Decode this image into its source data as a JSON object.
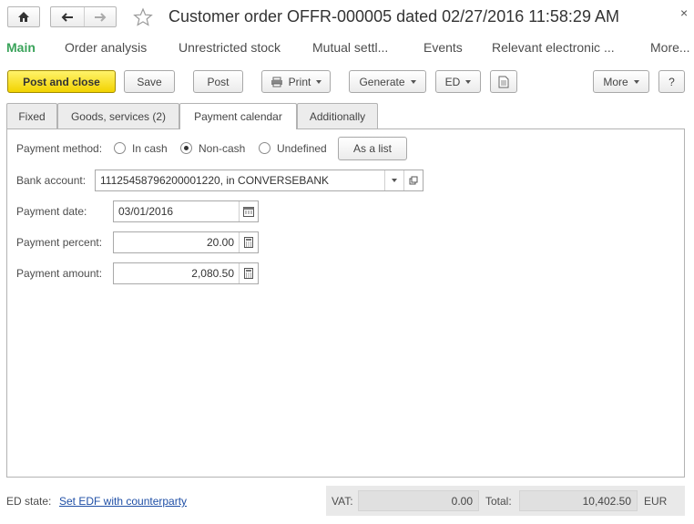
{
  "window": {
    "title": "Customer order OFFR-000005 dated 02/27/2016 11:58:29 AM",
    "close_glyph": "×"
  },
  "sections": {
    "main": "Main",
    "order_analysis": "Order analysis",
    "unrestricted_stock": "Unrestricted stock",
    "mutual_settl": "Mutual settl...",
    "events": "Events",
    "relevant_electronic": "Relevant electronic ...",
    "more": "More..."
  },
  "toolbar": {
    "post_and_close": "Post and close",
    "save": "Save",
    "post": "Post",
    "print": "Print",
    "generate": "Generate",
    "ed": "ED",
    "more": "More",
    "help": "?"
  },
  "tabs": {
    "fixed": "Fixed",
    "goods_services": "Goods, services (2)",
    "payment_calendar": "Payment calendar",
    "additionally": "Additionally"
  },
  "form": {
    "payment_method_label": "Payment method:",
    "payment_methods": [
      "In cash",
      "Non-cash",
      "Undefined"
    ],
    "selected_payment_method": "Non-cash",
    "as_list_button": "As a list",
    "bank_account_label": "Bank account:",
    "bank_account_value": "11125458796200001220, in CONVERSEBANK",
    "payment_date_label": "Payment date:",
    "payment_date_value": "03/01/2016",
    "payment_percent_label": "Payment percent:",
    "payment_percent_value": "20.00",
    "payment_amount_label": "Payment amount:",
    "payment_amount_value": "2,080.50"
  },
  "footer": {
    "ed_state_label": "ED state:",
    "ed_state_link": "Set EDF with counterparty",
    "vat_label": "VAT:",
    "vat_value": "0.00",
    "total_label": "Total:",
    "total_value": "10,402.50",
    "currency": "EUR"
  },
  "colors": {
    "primary_button": "#f2d300",
    "active_section": "#3aa35a",
    "link": "#1f4fa6"
  }
}
